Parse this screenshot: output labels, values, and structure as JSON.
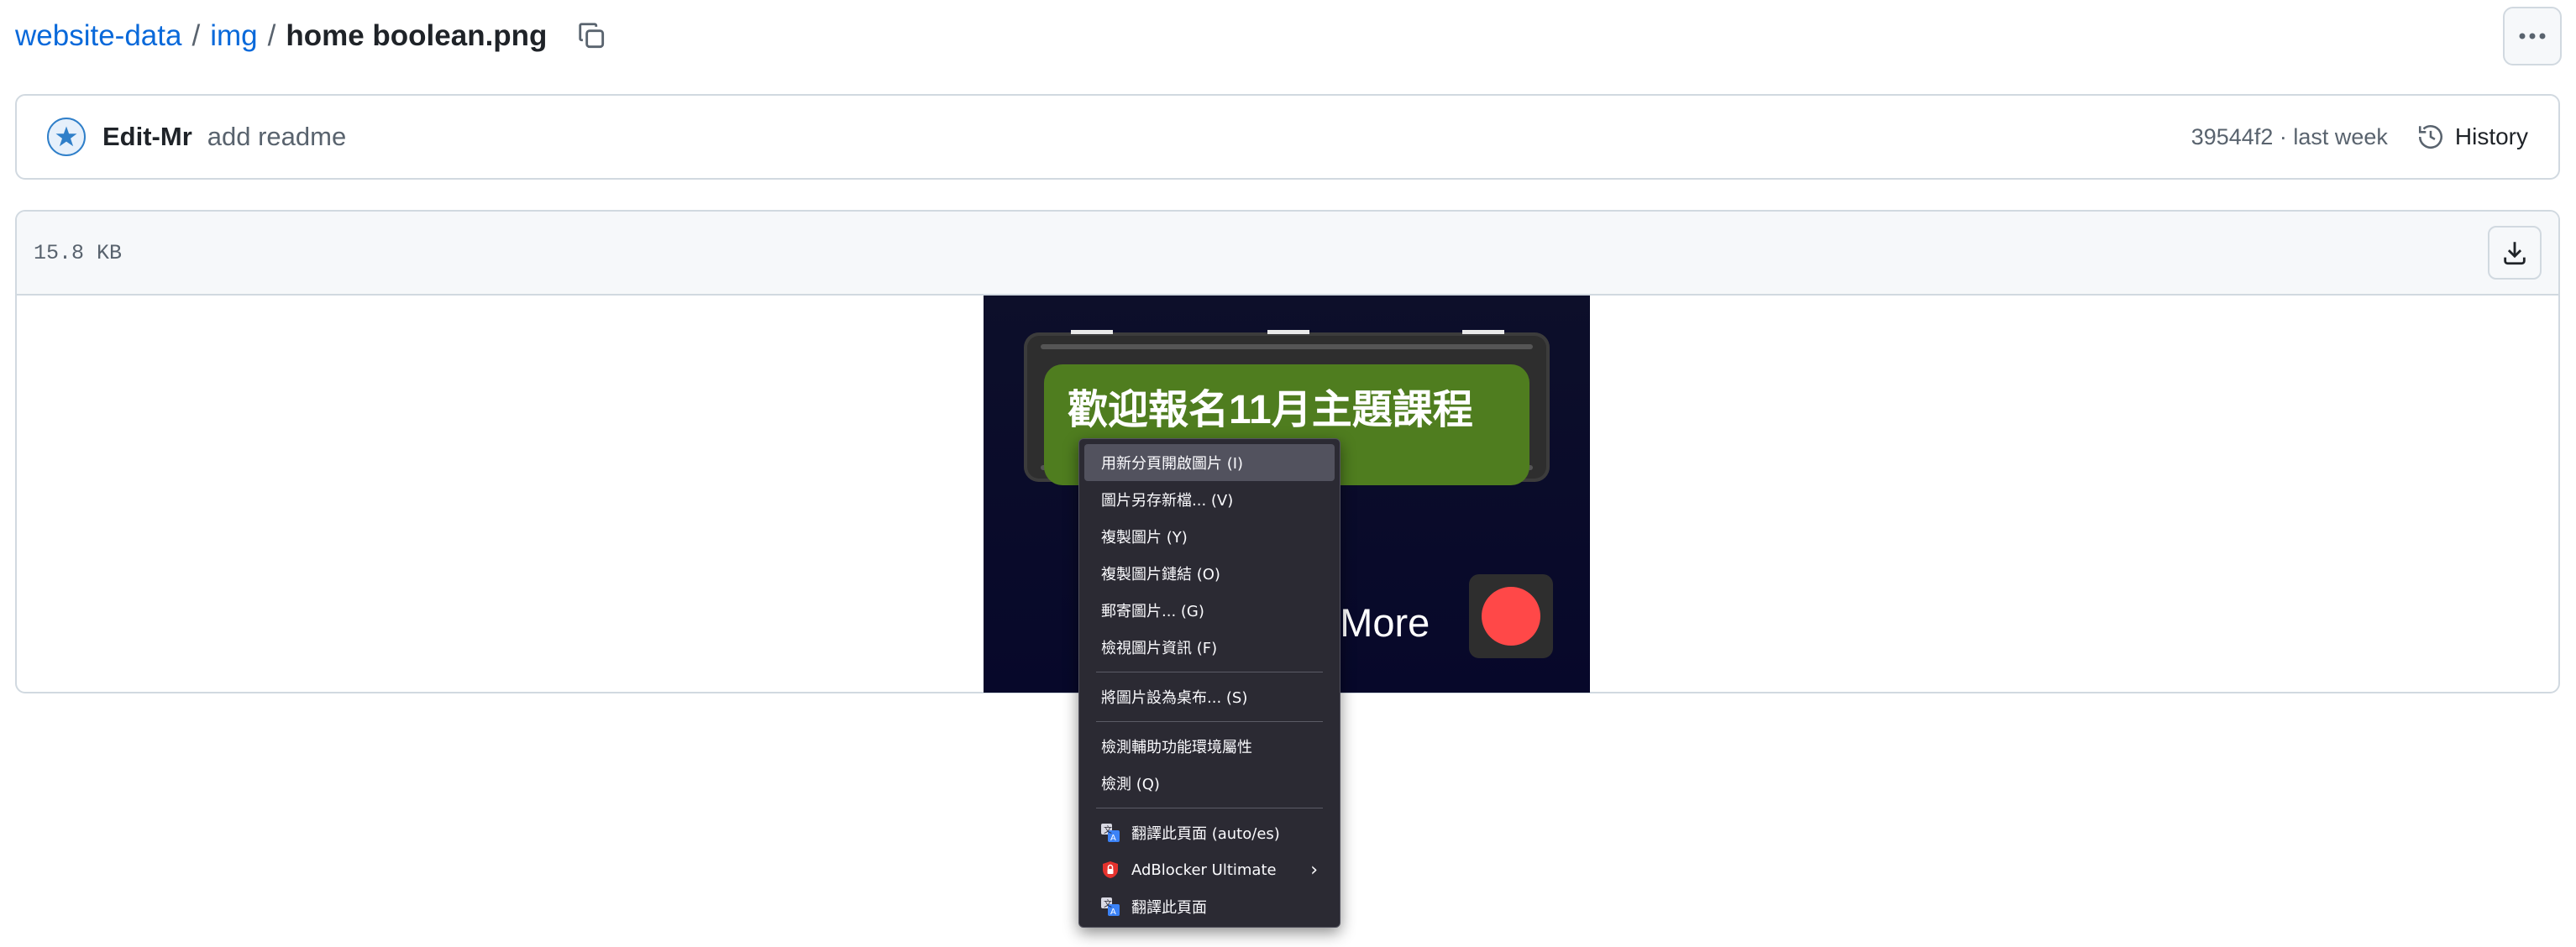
{
  "breadcrumb": {
    "repo": "website-data",
    "folder": "img",
    "file": "home boolean.png",
    "separator": "/"
  },
  "commit": {
    "author": "Edit-Mr",
    "message": "add readme",
    "meta": "39544f2 · last week",
    "history_label": "History"
  },
  "file": {
    "size": "15.8 KB"
  },
  "preview": {
    "sign_text": "歡迎報名11月主題課程",
    "learn_more": "n More"
  },
  "context_menu": {
    "items": [
      {
        "label": "用新分頁開啟圖片 (I)"
      },
      {
        "label": "圖片另存新檔... (V)"
      },
      {
        "label": "複製圖片 (Y)"
      },
      {
        "label": "複製圖片鏈結 (O)"
      },
      {
        "label": "郵寄圖片... (G)"
      },
      {
        "label": "檢視圖片資訊 (F)"
      },
      {
        "label": "將圖片設為桌布... (S)"
      },
      {
        "label": "檢測輔助功能環境屬性"
      },
      {
        "label": "檢測 (Q)"
      },
      {
        "label": "翻譯此頁面 (auto/es)",
        "icon": "translate-icon"
      },
      {
        "label": "AdBlocker Ultimate",
        "icon": "adblocker-icon"
      },
      {
        "label": "翻譯此頁面",
        "icon": "translate-icon"
      }
    ]
  },
  "colors": {
    "link": "#0969da",
    "menu_bg": "#2b2a33",
    "menu_highlight": "#52525e",
    "sign_green": "#4f7d1f",
    "record_red": "#ff4848"
  }
}
